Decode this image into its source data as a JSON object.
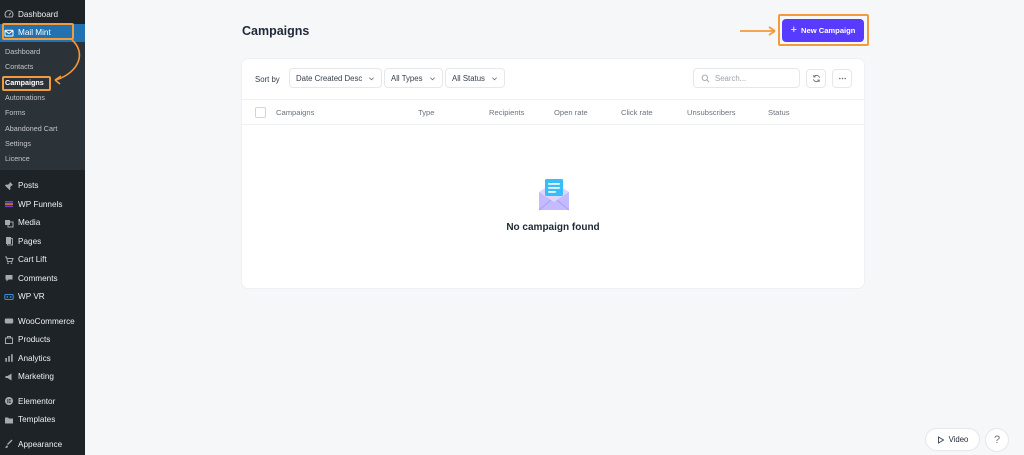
{
  "sidebar": {
    "top_items": [
      {
        "label": "Dashboard",
        "icon": "dashboard-icon"
      },
      {
        "label": "Mail Mint",
        "icon": "mail-icon"
      }
    ],
    "submenu": [
      {
        "label": "Dashboard"
      },
      {
        "label": "Contacts"
      },
      {
        "label": "Campaigns"
      },
      {
        "label": "Automations"
      },
      {
        "label": "Forms"
      },
      {
        "label": "Abandoned Cart"
      },
      {
        "label": "Settings"
      },
      {
        "label": "Licence"
      }
    ],
    "group1": [
      {
        "label": "Posts",
        "icon": "pin-icon"
      },
      {
        "label": "WP Funnels",
        "icon": "funnel-icon"
      },
      {
        "label": "Media",
        "icon": "media-icon"
      },
      {
        "label": "Pages",
        "icon": "pages-icon"
      },
      {
        "label": "Cart Lift",
        "icon": "cart-icon"
      },
      {
        "label": "Comments",
        "icon": "comment-icon"
      },
      {
        "label": "WP VR",
        "icon": "vr-icon"
      }
    ],
    "group2": [
      {
        "label": "WooCommerce",
        "icon": "woo-icon"
      },
      {
        "label": "Products",
        "icon": "products-icon"
      },
      {
        "label": "Analytics",
        "icon": "analytics-icon"
      },
      {
        "label": "Marketing",
        "icon": "megaphone-icon"
      }
    ],
    "group3": [
      {
        "label": "Elementor",
        "icon": "elementor-icon"
      },
      {
        "label": "Templates",
        "icon": "templates-icon"
      }
    ],
    "group4": [
      {
        "label": "Appearance",
        "icon": "appearance-icon"
      }
    ]
  },
  "header": {
    "title": "Campaigns",
    "new_button": "New Campaign"
  },
  "toolbar": {
    "sort_label": "Sort by",
    "sort_value": "Date Created Desc",
    "type_value": "All Types",
    "status_value": "All Status",
    "search_placeholder": "Search..."
  },
  "table": {
    "columns": [
      "Campaigns",
      "Type",
      "Recipients",
      "Open rate",
      "Click rate",
      "Unsubscribers",
      "Status"
    ]
  },
  "empty_state": {
    "message": "No campaign found"
  },
  "footer": {
    "video_label": "Video",
    "help_label": "?"
  },
  "colors": {
    "accent": "#573bff",
    "sidebar_bg": "#1d2327",
    "highlight": "#f39a3a"
  }
}
